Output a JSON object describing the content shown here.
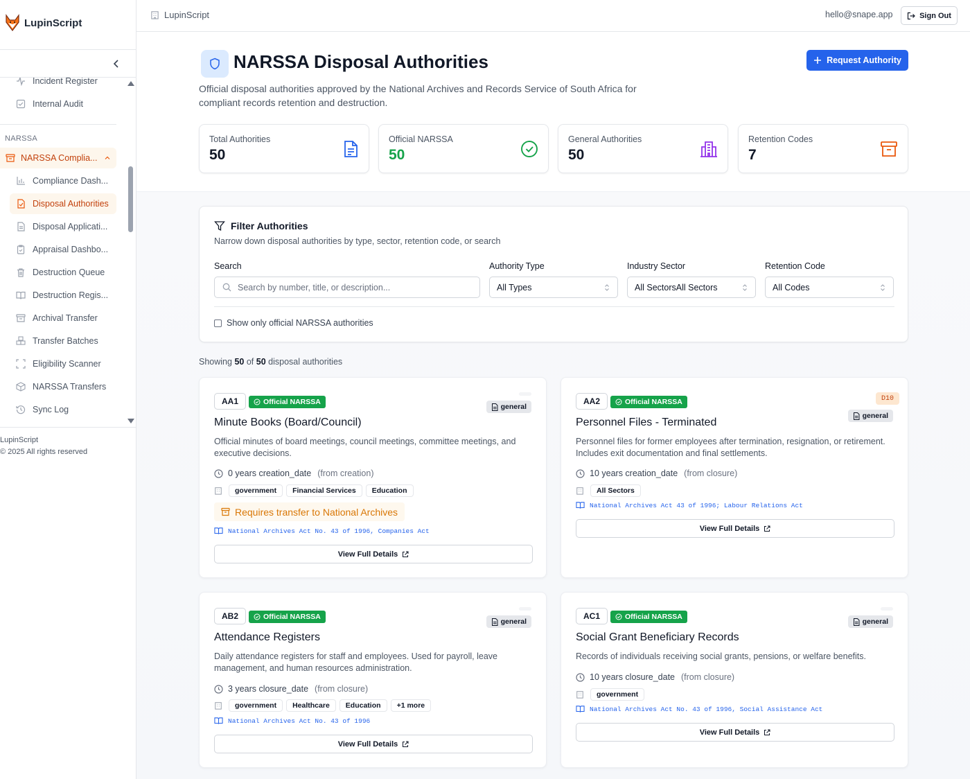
{
  "app": {
    "name": "LupinScript"
  },
  "topbar": {
    "breadcrumb": "LupinScript",
    "email": "hello@snape.app",
    "sign_out_label": "Sign Out"
  },
  "sidebar": {
    "items_top": [
      {
        "label": "Incident Register",
        "icon": "activity-icon"
      },
      {
        "label": "Internal Audit",
        "icon": "checkbox-icon"
      }
    ],
    "section_label": "NARSSA",
    "group_label": "NARSSA Complia...",
    "items": [
      {
        "label": "Compliance Dash...",
        "icon": "bar-chart-icon"
      },
      {
        "label": "Disposal Authorities",
        "icon": "file-check-icon"
      },
      {
        "label": "Disposal Applicati...",
        "icon": "file-text-icon"
      },
      {
        "label": "Appraisal Dashbo...",
        "icon": "clipboard-icon"
      },
      {
        "label": "Destruction Queue",
        "icon": "trash-icon"
      },
      {
        "label": "Destruction Regis...",
        "icon": "book-icon"
      },
      {
        "label": "Archival Transfer",
        "icon": "archive-icon"
      },
      {
        "label": "Transfer Batches",
        "icon": "boxes-icon"
      },
      {
        "label": "Eligibility Scanner",
        "icon": "scan-icon"
      },
      {
        "label": "NARSSA Transfers",
        "icon": "package-icon"
      },
      {
        "label": "Sync Log",
        "icon": "history-icon"
      }
    ],
    "footer_brand": "LupinScript",
    "footer_copyright": "© 2025 All rights reserved"
  },
  "page": {
    "title": "NARSSA Disposal Authorities",
    "description": "Official disposal authorities approved by the National Archives and Records Service of South Africa for compliant records retention and destruction.",
    "request_button": "Request Authority"
  },
  "stats": [
    {
      "label": "Total Authorities",
      "value": "50",
      "color": "#111827",
      "icon": "file-text-icon",
      "icon_color": "#2563eb"
    },
    {
      "label": "Official NARSSA",
      "value": "50",
      "color": "#16a34a",
      "icon": "check-circle-icon",
      "icon_color": "#16a34a"
    },
    {
      "label": "General Authorities",
      "value": "50",
      "color": "#111827",
      "icon": "building-icon",
      "icon_color": "#9333ea"
    },
    {
      "label": "Retention Codes",
      "value": "7",
      "color": "#111827",
      "icon": "archive-icon",
      "icon_color": "#ea580c"
    }
  ],
  "filters": {
    "title": "Filter Authorities",
    "description": "Narrow down disposal authorities by type, sector, retention code, or search",
    "search_label": "Search",
    "search_placeholder": "Search by number, title, or description...",
    "type_label": "Authority Type",
    "type_value": "All Types",
    "sector_label": "Industry Sector",
    "sector_value": "All SectorsAll Sectors",
    "code_label": "Retention Code",
    "code_value": "All Codes",
    "official_only_label": "Show only official NARSSA authorities"
  },
  "results": {
    "prefix": "Showing",
    "shown": "50",
    "of": "of",
    "total": "50",
    "suffix": "disposal authorities"
  },
  "cards": [
    {
      "code": "AA1",
      "official_label": "Official NARSSA",
      "retention_code": "",
      "category": "general",
      "title": "Minute Books (Board/Council)",
      "description": "Official minutes of board meetings, council meetings, committee meetings, and executive decisions.",
      "retention": "0 years creation_date",
      "retention_from": "(from creation)",
      "sectors": [
        "government",
        "Financial Services",
        "Education"
      ],
      "transfer": "Requires transfer to National Archives",
      "legislation": "National Archives Act No. 43 of 1996, Companies Act",
      "view_label": "View Full Details"
    },
    {
      "code": "AA2",
      "official_label": "Official NARSSA",
      "retention_code": "D10",
      "category": "general",
      "title": "Personnel Files - Terminated",
      "description": "Personnel files for former employees after termination, resignation, or retirement. Includes exit documentation and final settlements.",
      "retention": "10 years creation_date",
      "retention_from": "(from closure)",
      "sectors": [
        "All Sectors"
      ],
      "transfer": "",
      "legislation": "National Archives Act 43 of 1996; Labour Relations Act",
      "view_label": "View Full Details"
    },
    {
      "code": "AB2",
      "official_label": "Official NARSSA",
      "retention_code": "",
      "category": "general",
      "title": "Attendance Registers",
      "description": "Daily attendance registers for staff and employees. Used for payroll, leave management, and human resources administration.",
      "retention": "3 years closure_date",
      "retention_from": "(from closure)",
      "sectors": [
        "government",
        "Healthcare",
        "Education",
        "+1 more"
      ],
      "transfer": "",
      "legislation": "National Archives Act No. 43 of 1996",
      "view_label": "View Full Details"
    },
    {
      "code": "AC1",
      "official_label": "Official NARSSA",
      "retention_code": "",
      "category": "general",
      "title": "Social Grant Beneficiary Records",
      "description": "Records of individuals receiving social grants, pensions, or welfare benefits.",
      "retention": "10 years closure_date",
      "retention_from": "(from closure)",
      "sectors": [
        "government"
      ],
      "transfer": "",
      "legislation": "National Archives Act No. 43 of 1996, Social Assistance Act",
      "view_label": "View Full Details"
    }
  ]
}
